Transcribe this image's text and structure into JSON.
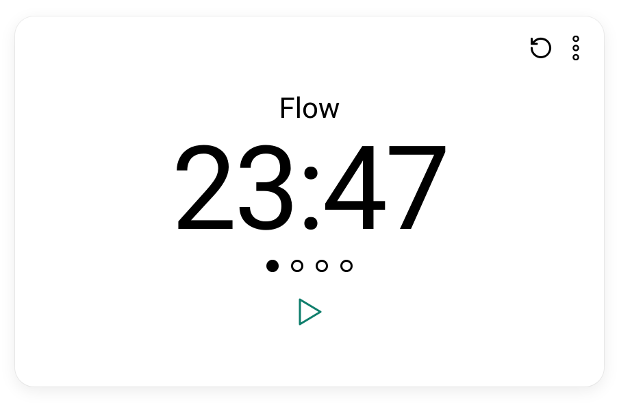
{
  "session": {
    "title": "Flow",
    "timer": "23:47"
  },
  "progress": {
    "total_dots": 4,
    "active_index": 0
  },
  "icons": {
    "reset": "reset-icon",
    "more": "more-icon",
    "play": "play-icon"
  },
  "colors": {
    "play_accent": "#0f7e6c"
  }
}
